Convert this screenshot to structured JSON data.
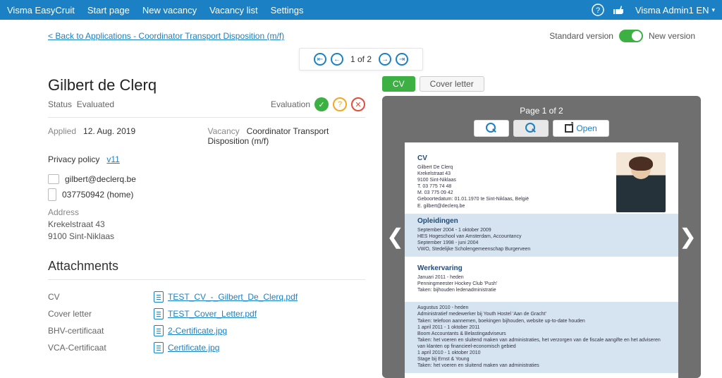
{
  "nav": {
    "brand": "Visma EasyCruit",
    "items": [
      "Start page",
      "New vacancy",
      "Vacancy list",
      "Settings"
    ],
    "user": "Visma Admin1 EN"
  },
  "subbar": {
    "back_link": "< Back to Applications - Coordinator Transport Disposition (m/f)",
    "std_label": "Standard version",
    "new_label": "New version"
  },
  "pager": {
    "text": "1 of 2"
  },
  "candidate": {
    "name": "Gilbert de Clerq",
    "status_label": "Status",
    "status_value": "Evaluated",
    "evaluation_label": "Evaluation",
    "applied_label": "Applied",
    "applied_value": "12. Aug. 2019",
    "vacancy_label": "Vacancy",
    "vacancy_value": "Coordinator Transport Disposition (m/f)",
    "privacy_label": "Privacy policy",
    "privacy_value": "v11",
    "email": "gilbert@declerq.be",
    "phone": "037750942 (home)",
    "address_label": "Address",
    "address_line1": "Krekelstraat 43",
    "address_line2": "9100 Sint-Niklaas"
  },
  "attachments": {
    "heading": "Attachments",
    "rows": [
      {
        "type": "CV",
        "file": "TEST_CV_-_Gilbert_De_Clerq.pdf"
      },
      {
        "type": "Cover letter",
        "file": "TEST_Cover_Letter.pdf"
      },
      {
        "type": "BHV-certificaat",
        "file": "2-Certificate.jpg"
      },
      {
        "type": "VCA-Certificaat",
        "file": "Certificate.jpg"
      }
    ]
  },
  "viewer": {
    "tab_cv": "CV",
    "tab_cover": "Cover letter",
    "page_of": "Page 1 of 2",
    "open_label": "Open"
  },
  "cv_preview": {
    "h_cv": "CV",
    "name": "Gilbert De Clerq",
    "line1": "Krekelstraat 43",
    "line2": "9100 Sint-Niklaas",
    "line3": "T. 03 775 74 48",
    "line4": "M. 03 775 09 42",
    "line5": "Geboortedatum: 01.01.1970 te Sint-Niklaas, België",
    "line6": "E. gilbert@declerq.be",
    "h_edu": "Opleidingen",
    "edu1": "September 2004 - 1 oktober 2009",
    "edu2": "HES Hogeschool van Amsterdam, Accountancy",
    "edu3": "September 1998 - juni 2004",
    "edu4": "VWO, Stedelijke Scholengemeenschap Burgerveen",
    "h_work": "Werkervaring",
    "w1": "Januari 2011 - heden",
    "w2": "Penningmeester Hockey Club 'Push'",
    "w3": "Taken: bijhouden ledenadministratie",
    "w4": "Augustus 2010 - heden",
    "w5": "Administratief medewerker bij Youth Hostel 'Aan de Gracht'",
    "w6": "Taken: telefoon aannemen, boekingen bijhouden, website up-to-date houden",
    "w7": "1 april 2011 - 1 oktober 2011",
    "w8": "Boom Accountants & Belastingadviseurs",
    "w9": "Taken: het voeren en sluitend maken van administraties, het verzorgen van de fiscale aangifte en het adviseren van klanten op financieel-economisch gebied",
    "w10": "1 april 2010 - 1 oktober 2010",
    "w11": "Stage bij Ernst & Young",
    "w12": "Taken: het voeren en sluitend maken van administraties"
  }
}
